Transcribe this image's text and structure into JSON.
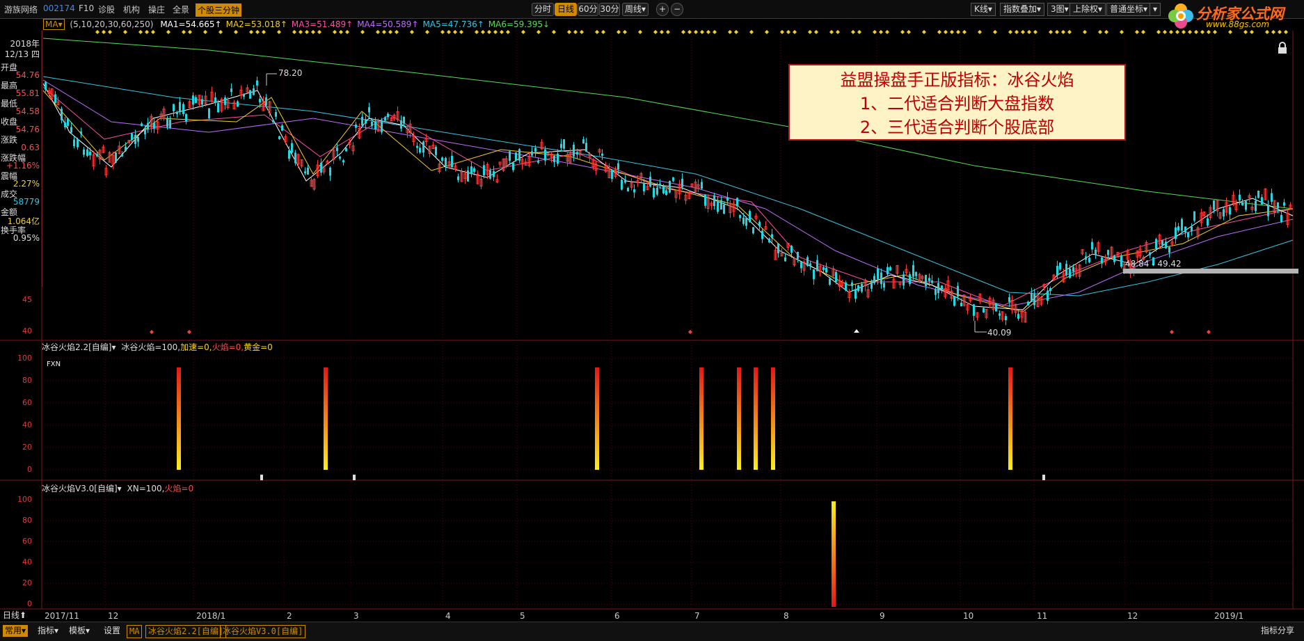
{
  "toolbar": {
    "stock_name": "游族网络",
    "stock_code": "002174",
    "links": [
      "F10",
      "诊股",
      "机构",
      "操庄",
      "全景"
    ],
    "active_link": "个股三分钟",
    "periods": [
      "分时",
      "日线",
      "60分",
      "30分",
      "周线▾"
    ],
    "selected_period": "日线",
    "zoom_in": "+",
    "zoom_out": "−",
    "right_dropdowns": [
      "K线▾",
      "指数叠加▾",
      "3图▾",
      "上除权▾",
      "普通坐标▾",
      "▾"
    ],
    "win_buttons": [
      "□",
      "□",
      "×"
    ]
  },
  "logo": {
    "text": "分析家公式网",
    "url_text": "www.88gs.com"
  },
  "ma_line": {
    "tag": "MA▾",
    "params": "(5,10,20,30,60,250)",
    "items": [
      {
        "label": "MA1=54.665↑",
        "color": "#ffffff"
      },
      {
        "label": "MA2=53.018↑",
        "color": "#f5d020"
      },
      {
        "label": "MA3=51.489↑",
        "color": "#ff4fa8"
      },
      {
        "label": "MA4=50.589↑",
        "color": "#c06cff"
      },
      {
        "label": "MA5=47.736↑",
        "color": "#34c6e6"
      },
      {
        "label": "MA6=59.395↓",
        "color": "#52e052"
      }
    ]
  },
  "info_panel": {
    "date_year": "2018年",
    "date_md": "12/13 四",
    "rows": [
      {
        "label": "开盘",
        "value": "54.76",
        "color": "#ff4a4a"
      },
      {
        "label": "最高",
        "value": "55.81",
        "color": "#ff4a4a"
      },
      {
        "label": "最低",
        "value": "54.58",
        "color": "#ff4a4a"
      },
      {
        "label": "收盘",
        "value": "54.76",
        "color": "#ff4a4a"
      },
      {
        "label": "涨跌",
        "value": "0.63",
        "color": "#ff4a4a"
      },
      {
        "label": "涨跌幅",
        "value": "+1.16%",
        "color": "#ff4a4a"
      },
      {
        "label": "震幅",
        "value": "2.27%",
        "color": "#f5d020"
      },
      {
        "label": "成交",
        "value": "58779",
        "color": "#34c6e6"
      },
      {
        "label": "金额",
        "value": "1.064亿",
        "color": "#f5d020"
      },
      {
        "label": "换手率",
        "value": "0.95%",
        "color": "#dddddd"
      }
    ]
  },
  "main_chart": {
    "y_ticks": [
      "45",
      "40"
    ],
    "annotations": {
      "high": "78.20",
      "low": "40.09",
      "range": "48.84 - 49.42"
    }
  },
  "annotation_box": {
    "line1": "益盟操盘手正版指标：冰谷火焰",
    "line2": "1、二代适合判断大盘指数",
    "line3": "2、三代适合判断个股底部"
  },
  "panel1": {
    "name": "冰谷火焰2.2[自编]▾",
    "params": "冰谷火焰=100,",
    "accel": "加速=0,",
    "fire": "火焰=0,",
    "gold": "黄金=0",
    "tag": "FXN",
    "y_ticks": [
      "100",
      "80",
      "60",
      "40",
      "20",
      "0"
    ]
  },
  "panel2": {
    "name": "冰谷火焰V3.0[自编]▾",
    "params": "XN=100,",
    "fire": "火焰=0",
    "y_ticks": [
      "100",
      "80",
      "60",
      "40",
      "20",
      "0"
    ]
  },
  "x_axis": [
    "2017/11",
    "12",
    "2018/1",
    "2",
    "3",
    "4",
    "5",
    "6",
    "7",
    "8",
    "9",
    "10",
    "11",
    "12",
    "2019/1"
  ],
  "period_tag": "日线⬆",
  "bottom_tabs": {
    "common": "常用▾",
    "indicator": "指标▾",
    "template": "模板▾",
    "settings": "设置",
    "ma_tab": "MA",
    "ind1": "冰谷火焰2.2[自编]",
    "ind2": "冰谷火焰V3.0[自编]",
    "share": "指标分享"
  },
  "chart_data": {
    "type": "candlestick",
    "y_range_main": [
      40,
      80
    ],
    "panel1_bars": [
      {
        "x": "2017/12",
        "value": 92
      },
      {
        "x": "2018/2",
        "value": 92
      },
      {
        "x": "2018/5",
        "value": 92
      },
      {
        "x": "2018/7",
        "value": 92
      },
      {
        "x": "2018/7",
        "value": 92
      },
      {
        "x": "2018/7",
        "value": 92
      },
      {
        "x": "2018/7",
        "value": 92
      },
      {
        "x": "2018/10",
        "value": 92
      }
    ],
    "panel2_bars": [
      {
        "x": "2018/8",
        "value": 92
      }
    ]
  }
}
